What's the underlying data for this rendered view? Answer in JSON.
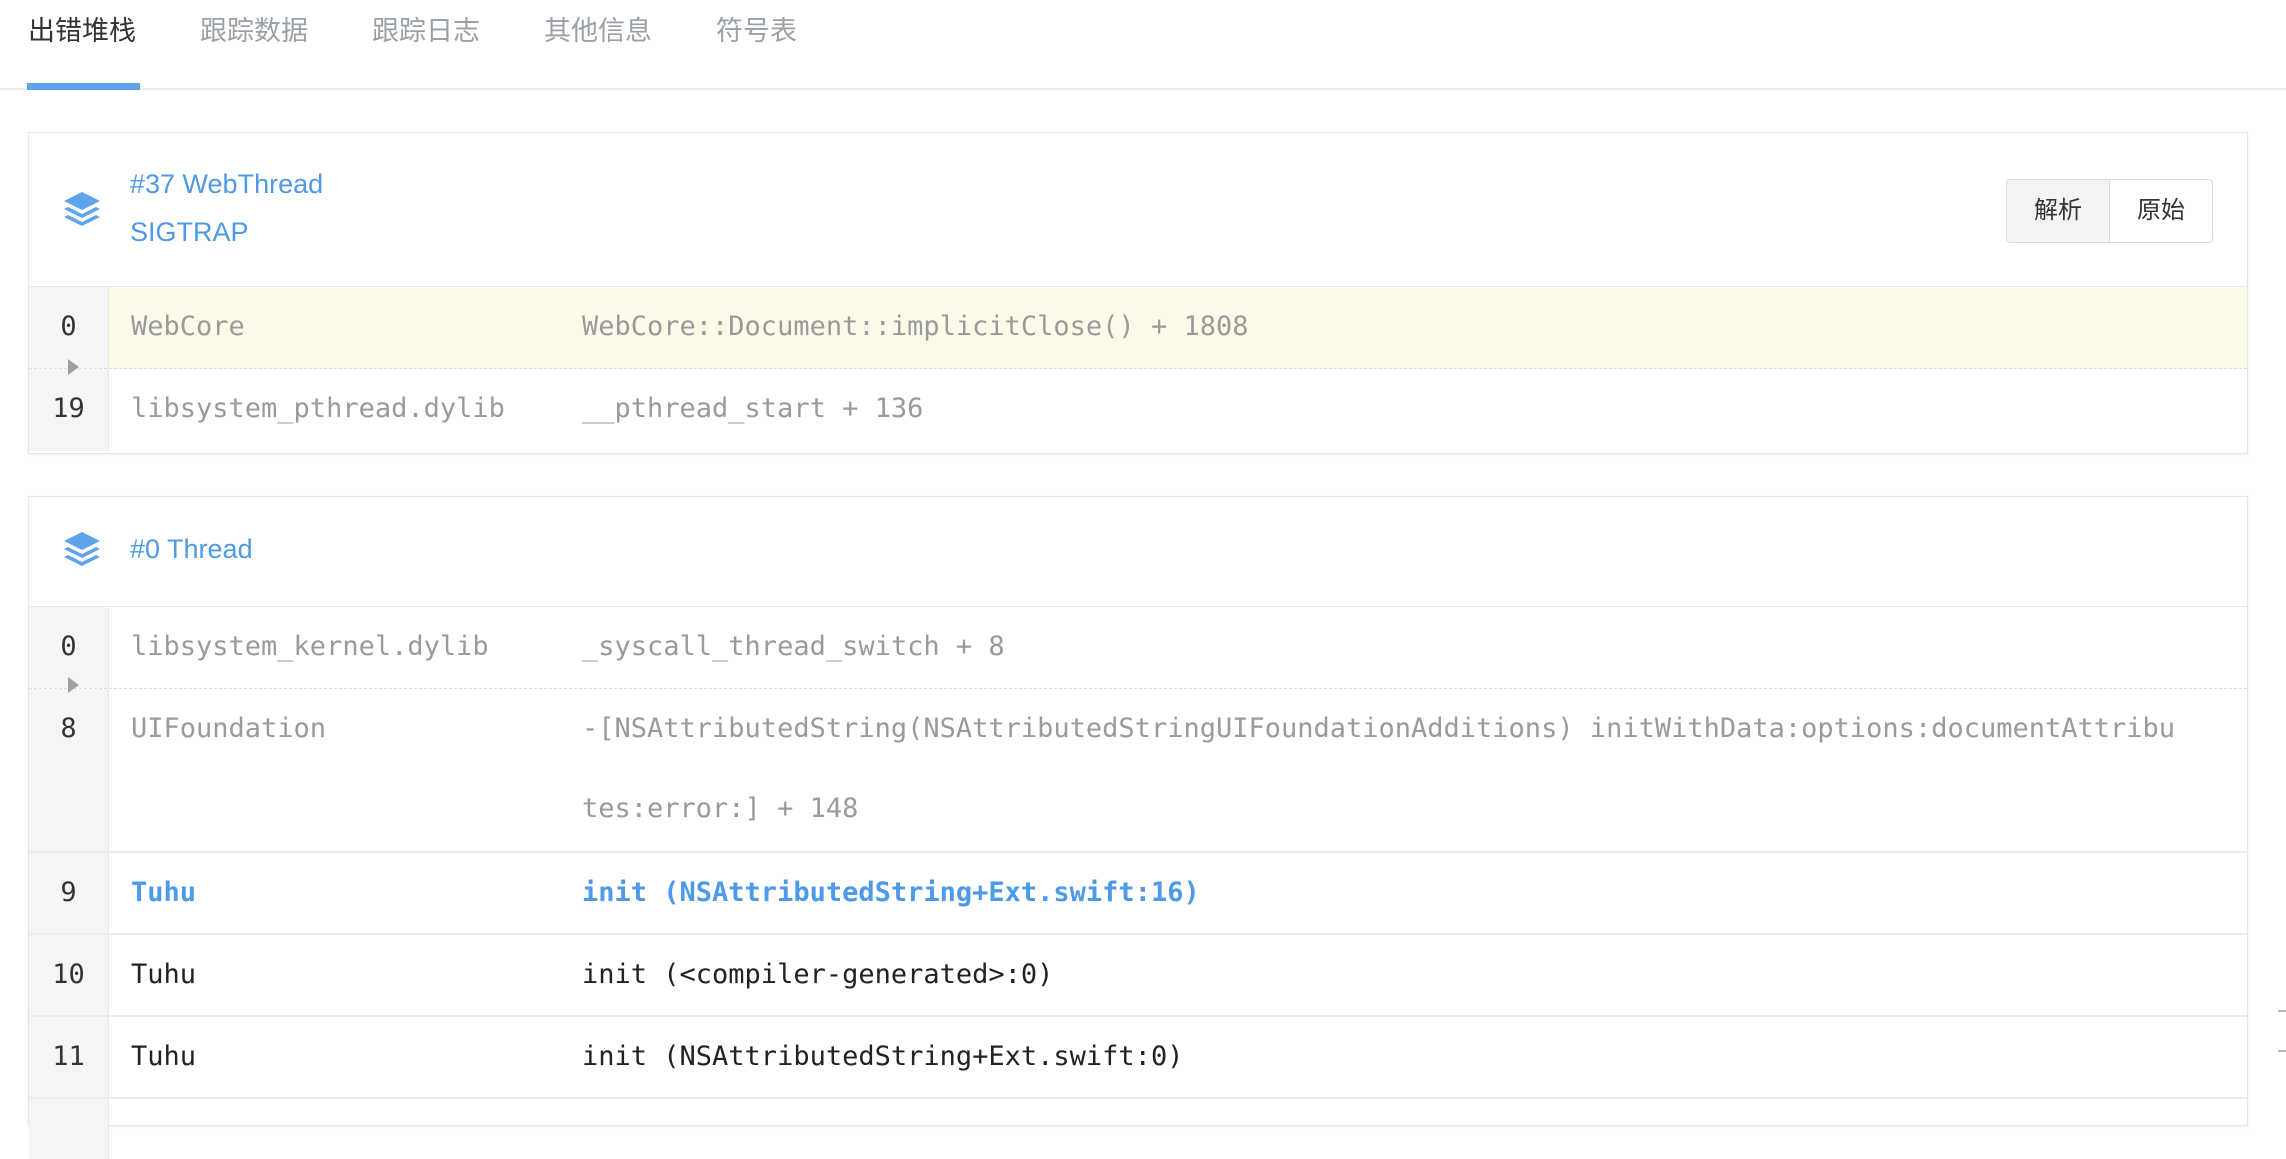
{
  "tabs": [
    {
      "label": "出错堆栈",
      "active": true
    },
    {
      "label": "跟踪数据",
      "active": false
    },
    {
      "label": "跟踪日志",
      "active": false
    },
    {
      "label": "其他信息",
      "active": false
    },
    {
      "label": "符号表",
      "active": false
    }
  ],
  "panels": [
    {
      "title": "#37 WebThread",
      "subtitle": "SIGTRAP",
      "icon": "layers-icon",
      "view_toggle": {
        "parsed_label": "解析",
        "raw_label": "原始",
        "selected": "解析"
      },
      "frames": [
        {
          "index": "0",
          "library": "WebCore",
          "symbol": "WebCore::Document::implicitClose() + 1808",
          "style": "gray",
          "highlight": true
        },
        {
          "index": "19",
          "library": "libsystem_pthread.dylib",
          "symbol": "__pthread_start + 136",
          "style": "gray"
        }
      ]
    },
    {
      "title": "#0 Thread",
      "icon": "layers-icon",
      "frames": [
        {
          "index": "0",
          "library": "libsystem_kernel.dylib",
          "symbol": "_syscall_thread_switch + 8",
          "style": "gray"
        },
        {
          "index": "8",
          "library": "UIFoundation",
          "symbol": "-[NSAttributedString(NSAttributedStringUIFoundationAdditions) initWithData:options:documentAttributes:error:] + 148",
          "style": "gray"
        },
        {
          "index": "9",
          "library": "Tuhu",
          "symbol": "init (NSAttributedString+Ext.swift:16)",
          "style": "app"
        },
        {
          "index": "10",
          "library": "Tuhu",
          "symbol": "init (<compiler-generated>:0)",
          "style": "normal"
        },
        {
          "index": "11",
          "library": "Tuhu",
          "symbol": "init (NSAttributedString+Ext.swift:0)",
          "style": "normal"
        }
      ]
    }
  ],
  "colors": {
    "accent": "#5fa3eb",
    "link": "#4d9ae6",
    "highlight_row": "#fcfbea",
    "muted_text": "#9a9a9a"
  }
}
